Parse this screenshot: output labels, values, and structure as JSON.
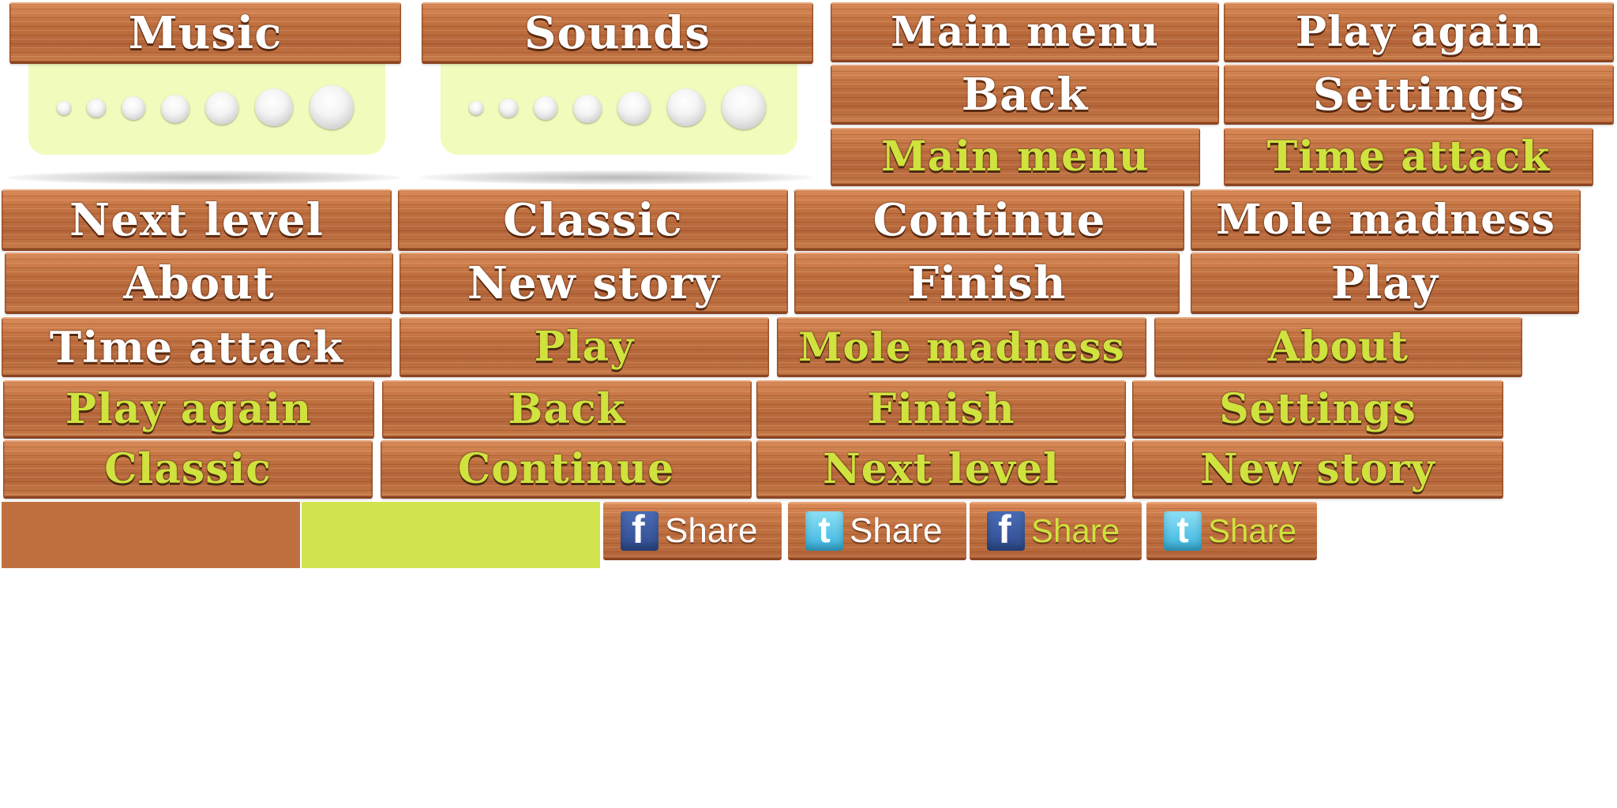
{
  "colors": {
    "wood": "#c0703f",
    "text_white": "#ffffff",
    "text_green": "#cfe23e",
    "panel": "#f1fbbc",
    "swatch_brown": "#c0703f",
    "swatch_green": "#d1e44d"
  },
  "sliders": {
    "music": {
      "label": "Music"
    },
    "sounds": {
      "label": "Sounds"
    }
  },
  "buttons": {
    "white": {
      "main_menu": "Main menu",
      "play_again": "Play again",
      "back": "Back",
      "settings": "Settings",
      "next_level": "Next level",
      "classic": "Classic",
      "continue": "Continue",
      "mole_madness": "Mole madness",
      "about": "About",
      "new_story": "New story",
      "finish": "Finish",
      "play": "Play",
      "time_attack": "Time attack"
    },
    "green": {
      "main_menu": "Main menu",
      "time_attack": "Time attack",
      "play": "Play",
      "mole_madness": "Mole madness",
      "about": "About",
      "play_again": "Play again",
      "back": "Back",
      "finish": "Finish",
      "settings": "Settings",
      "classic": "Classic",
      "continue": "Continue",
      "next_level": "Next level",
      "new_story": "New story"
    }
  },
  "share": {
    "label": "Share",
    "facebook_glyph": "f",
    "twitter_glyph": "t"
  }
}
